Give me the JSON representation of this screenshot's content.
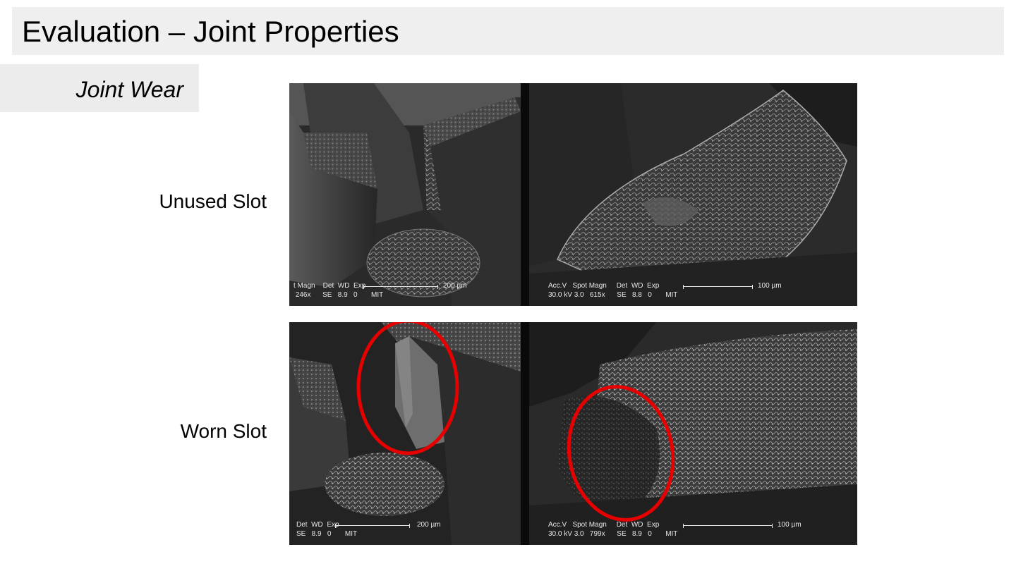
{
  "slide": {
    "title": "Evaluation – Joint Properties",
    "subtitle": "Joint Wear"
  },
  "rows": [
    {
      "label": "Unused Slot",
      "left_info_line1": "t Magn    Det  WD  Exp",
      "left_info_line2": " 246x      SE   8.9   0       MIT",
      "left_scale": "200 µm",
      "right_info_line1": "Acc.V   Spot Magn     Det  WD  Exp",
      "right_info_line2": "30.0 kV 3.0   615x      SE   8.8   0       MIT",
      "right_scale": "100 µm"
    },
    {
      "label": "Worn Slot",
      "left_info_line1": "Det  WD  Exp",
      "left_info_line2": "SE   8.9   0       MIT",
      "left_scale": "200 µm",
      "right_info_line1": "Acc.V   Spot Magn     Det  WD  Exp",
      "right_info_line2": "30.0 kV 3.0   799x      SE   8.9   0       MIT",
      "right_scale": "100 µm"
    }
  ],
  "colors": {
    "highlight": "#e60000",
    "title_bg": "#efefef"
  }
}
